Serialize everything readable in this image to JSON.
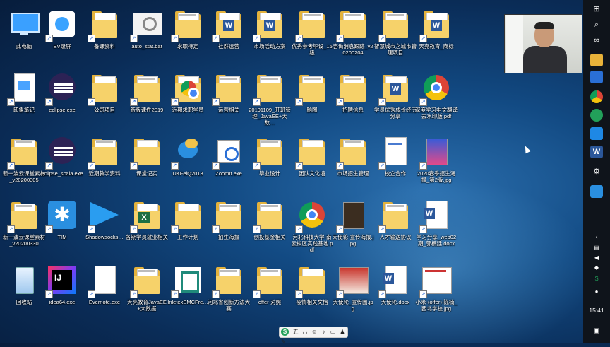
{
  "desktop": {
    "icons": [
      {
        "label": "此电脑",
        "kind": "pc"
      },
      {
        "label": "EV录屏",
        "kind": "app-ev"
      },
      {
        "label": "备课资料",
        "kind": "folder"
      },
      {
        "label": "auto_stat.bat",
        "kind": "bat"
      },
      {
        "label": "求职待定",
        "kind": "folder-doc"
      },
      {
        "label": "社群运营",
        "kind": "folder-word"
      },
      {
        "label": "市场活动方案",
        "kind": "folder-word"
      },
      {
        "label": "优秀参考毕设_15级",
        "kind": "folder-doc"
      },
      {
        "label": "咨询消息跟踪_v20200204",
        "kind": "folder-doc"
      },
      {
        "label": "智慧城市之城市管理项目",
        "kind": "folder-doc"
      },
      {
        "label": "天亮教育_商标",
        "kind": "folder-word"
      },
      {
        "label": "印象笔记",
        "kind": "app-note"
      },
      {
        "label": "eclipse.exe",
        "kind": "eclipse"
      },
      {
        "label": "公司项目",
        "kind": "folder"
      },
      {
        "label": "新版课件2019",
        "kind": "folder-doc"
      },
      {
        "label": "近期求职学员",
        "kind": "folder-chrome"
      },
      {
        "label": "运营相关",
        "kind": "folder-doc"
      },
      {
        "label": "20191109_开班管理_JavaEE+大数…",
        "kind": "folder-doc"
      },
      {
        "label": "脑图",
        "kind": "folder-doc"
      },
      {
        "label": "招聘信息",
        "kind": "folder-doc"
      },
      {
        "label": "学员优秀成长经历分享",
        "kind": "folder-word"
      },
      {
        "label": "深度学习中文翻译去水印版.pdf",
        "kind": "chrome"
      },
      {
        "label": "新一波云课堂素材_v20200305",
        "kind": "folder-doc"
      },
      {
        "label": "eclipse_scala.exe",
        "kind": "eclipse"
      },
      {
        "label": "近期教学资料",
        "kind": "folder-doc"
      },
      {
        "label": "课堂记实",
        "kind": "folder"
      },
      {
        "label": "UKFeiQ2013",
        "kind": "app-feiq"
      },
      {
        "label": "ZoomIt.exe",
        "kind": "app-zoom"
      },
      {
        "label": "毕业设计",
        "kind": "folder-doc"
      },
      {
        "label": "团队文化墙",
        "kind": "folder"
      },
      {
        "label": "市场招生管理",
        "kind": "folder-doc"
      },
      {
        "label": "校企合作",
        "kind": "doc"
      },
      {
        "label": "2020春季招生海报_第2版.jpg",
        "kind": "poster"
      },
      {
        "label": "新一波云课堂素材_v20200330",
        "kind": "folder-doc"
      },
      {
        "label": "TIM",
        "kind": "app-tim"
      },
      {
        "label": "Shadowsocks…",
        "kind": "app-ss"
      },
      {
        "label": "各期学员就业相关",
        "kind": "folder-excel"
      },
      {
        "label": "工作计划",
        "kind": "folder"
      },
      {
        "label": "招生海报",
        "kind": "folder-doc"
      },
      {
        "label": "创投基金相关",
        "kind": "folder-doc"
      },
      {
        "label": "河北科技大学-南云校区实践基地.pdf",
        "kind": "chrome"
      },
      {
        "label": "天使轮-宣传海报.jpg",
        "kind": "dark-poster"
      },
      {
        "label": "人才输送协议",
        "kind": "folder-doc"
      },
      {
        "label": "学习分享_web02期_郭楠廷.docx",
        "kind": "word-doc"
      },
      {
        "label": "回收站",
        "kind": "recycle"
      },
      {
        "label": "idea64.exe",
        "kind": "idea"
      },
      {
        "label": "Evernote.exe",
        "kind": "blank"
      },
      {
        "label": "天亮教育JavaEE+大数据",
        "kind": "folder-doc"
      },
      {
        "label": "InletexEMCFre…",
        "kind": "app-inletex"
      },
      {
        "label": "河北省创新方法大赛",
        "kind": "folder-doc"
      },
      {
        "label": "offer-对照",
        "kind": "folder-doc"
      },
      {
        "label": "疫情相关文档",
        "kind": "folder"
      },
      {
        "label": "天使轮_宣传图.jpg",
        "kind": "photo"
      },
      {
        "label": "天使轮.docx",
        "kind": "word-doc"
      },
      {
        "label": "小米-(offer)-陈楠_西北学校.jpg",
        "kind": "sheet"
      }
    ]
  },
  "ime_bar": {
    "label": "S",
    "mode": "五"
  },
  "taskbar": {
    "time": "15:41"
  }
}
